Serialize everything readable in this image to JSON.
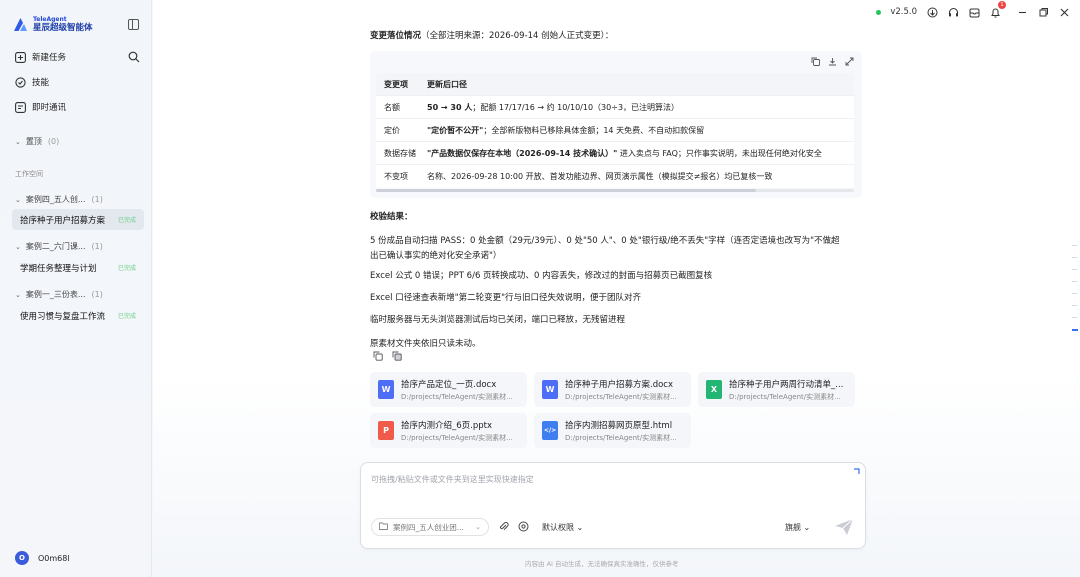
{
  "app": {
    "logo_small": "TeleAgent",
    "logo_big": "星辰超级智能体",
    "version": "v2.5.0",
    "notification_count": "1"
  },
  "sidebar": {
    "nav": [
      {
        "label": "新建任务",
        "icon": "new-task-icon"
      },
      {
        "label": "技能",
        "icon": "skill-icon"
      },
      {
        "label": "即时通讯",
        "icon": "im-icon"
      }
    ],
    "pinned_label": "置顶",
    "pinned_count": "(0)",
    "workspace_label": "工作空间",
    "groups": [
      {
        "label": "案例四_五人创...",
        "count": "(1)",
        "task": "拾序种子用户招募方案",
        "tag": "已完成"
      },
      {
        "label": "案例二_六门课...",
        "count": "(1)",
        "task": "学期任务整理与计划",
        "tag": "已完成"
      },
      {
        "label": "案例一_三份表...",
        "count": "(1)",
        "task": "使用习惯与复盘工作流",
        "tag": "已完成"
      }
    ],
    "user": {
      "avatar_letter": "O",
      "name": "O0m68l"
    }
  },
  "main": {
    "change_heading": "变更落位情况",
    "change_heading_note": "（全部注明来源：2026-09-14 创始人正式变更）：",
    "table": {
      "headers": [
        "变更项",
        "更新后口径"
      ],
      "rows": [
        {
          "item": "名额",
          "value_bold": "50 → 30 人",
          "value": "；配额 17/17/16 → 约 10/10/10（30÷3，已注明算法）"
        },
        {
          "item": "定价",
          "value_bold": "\"定价暂不公开\"",
          "value": "；全部新版物料已移除具体金额；14 天免费、不自动扣款保留"
        },
        {
          "item": "数据存储",
          "value_bold": "\"产品数据仅保存在本地（2026-09-14 技术确认）\"",
          "value": " 进入卖点与 FAQ；只作事实说明，未出现任何绝对化安全"
        },
        {
          "item": "不变项",
          "value_bold": "",
          "value": "名称、2026-09-28 10:00 开放、首发功能边界、网页演示属性（模拟提交≠报名）均已复核一致"
        }
      ]
    },
    "check_heading": "校验结果：",
    "check_lines": [
      "5 份成品自动扫描 PASS：0 处金额（29元/39元）、0 处\"50 人\"、0 处\"银行级/绝不丢失\"字样（连否定语境也改写为\"不做超",
      "出已确认事实的绝对化安全承诺\"）",
      "Excel 公式 0 错误；PPT 6/6 页转换成功、0 内容丢失，修改过的封面与招募页已截图复核",
      "Excel 口径速查表新增\"第二轮变更\"行与旧口径失效说明，便于团队对齐",
      "临时服务器与无头浏览器测试后均已关闭，端口已释放，无残留进程",
      "原素材文件夹依旧只读未动。"
    ],
    "files": [
      {
        "name": "拾序产品定位_一页.docx",
        "path": "D:/projects/TeleAgent/实测素材...",
        "type": "W",
        "color": "#4f6ef7"
      },
      {
        "name": "拾序种子用户招募方案.docx",
        "path": "D:/projects/TeleAgent/实测素材...",
        "type": "W",
        "color": "#4f6ef7"
      },
      {
        "name": "拾序种子用户两周行动清单_...",
        "path": "D:/projects/TeleAgent/实测素材...",
        "type": "X",
        "color": "#22b573"
      },
      {
        "name": "拾序内测介绍_6页.pptx",
        "path": "D:/projects/TeleAgent/实测素材...",
        "type": "P",
        "color": "#f05a4a"
      },
      {
        "name": "拾序内测招募网页原型.html",
        "path": "D:/projects/TeleAgent/实测素材...",
        "type": "</>",
        "color": "#3f7ef0"
      }
    ]
  },
  "input": {
    "placeholder": "可拖拽/粘贴文件或文件夹到这里实现快速指定",
    "workspace_chip": "案例四_五人创业团...",
    "permission": "默认权限",
    "model": "旗舰"
  },
  "footer_note": "内容由 AI 自动生成，无法确保真实准确性，仅供参考"
}
